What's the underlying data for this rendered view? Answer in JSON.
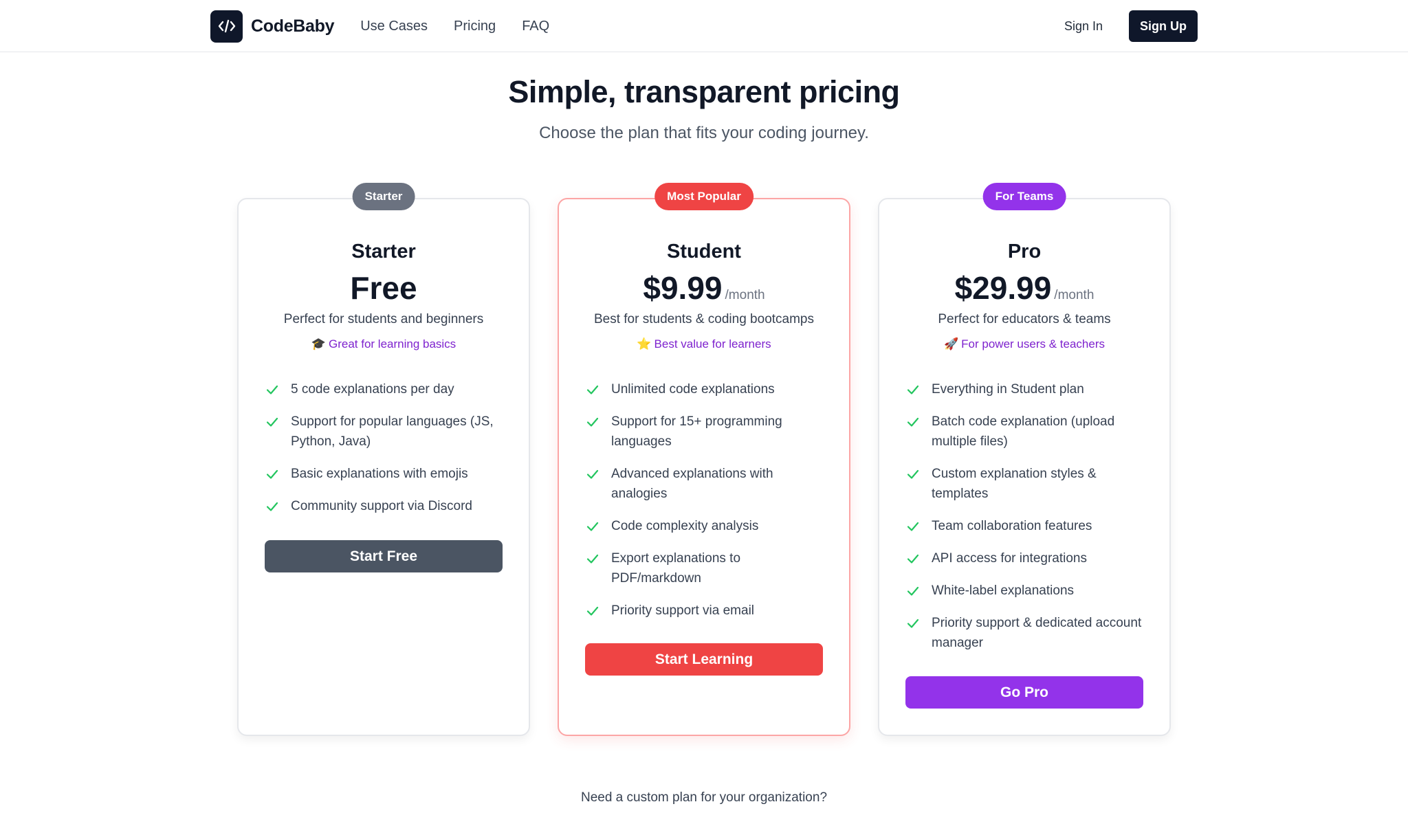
{
  "nav": {
    "brand": "CodeBaby",
    "links": [
      "Use Cases",
      "Pricing",
      "FAQ"
    ],
    "sign_in": "Sign In",
    "sign_up": "Sign Up"
  },
  "hero": {
    "title": "Simple, transparent pricing",
    "subtitle": "Choose the plan that fits your coding journey."
  },
  "plans": [
    {
      "badge": "Starter",
      "badge_color": "#6b7280",
      "name": "Starter",
      "price": "Free",
      "period": "",
      "description": "Perfect for students and beginners",
      "note_emoji": "🎓",
      "note": "Great for learning basics",
      "features": [
        "5 code explanations per day",
        "Support for popular languages (JS, Python, Java)",
        "Basic explanations with emojis",
        "Community support via Discord"
      ],
      "cta": "Start Free",
      "cta_color": "#4b5563"
    },
    {
      "badge": "Most Popular",
      "badge_color": "#ef4444",
      "name": "Student",
      "price": "$9.99",
      "period": "/month",
      "description": "Best for students & coding bootcamps",
      "note_emoji": "⭐",
      "note": "Best value for learners",
      "features": [
        "Unlimited code explanations",
        "Support for 15+ programming languages",
        "Advanced explanations with analogies",
        "Code complexity analysis",
        "Export explanations to PDF/markdown",
        "Priority support via email"
      ],
      "cta": "Start Learning",
      "cta_color": "#ef4444"
    },
    {
      "badge": "For Teams",
      "badge_color": "#9333ea",
      "name": "Pro",
      "price": "$29.99",
      "period": "/month",
      "description": "Perfect for educators & teams",
      "note_emoji": "🚀",
      "note": "For power users & teachers",
      "features": [
        "Everything in Student plan",
        "Batch code explanation (upload multiple files)",
        "Custom explanation styles & templates",
        "Team collaboration features",
        "API access for integrations",
        "White-label explanations",
        "Priority support & dedicated account manager"
      ],
      "cta": "Go Pro",
      "cta_color": "#9333ea"
    }
  ],
  "custom_plan_question": "Need a custom plan for your organization?",
  "colors": {
    "check": "#22c55e",
    "note": "#7e22ce",
    "dark": "#0f172a"
  }
}
